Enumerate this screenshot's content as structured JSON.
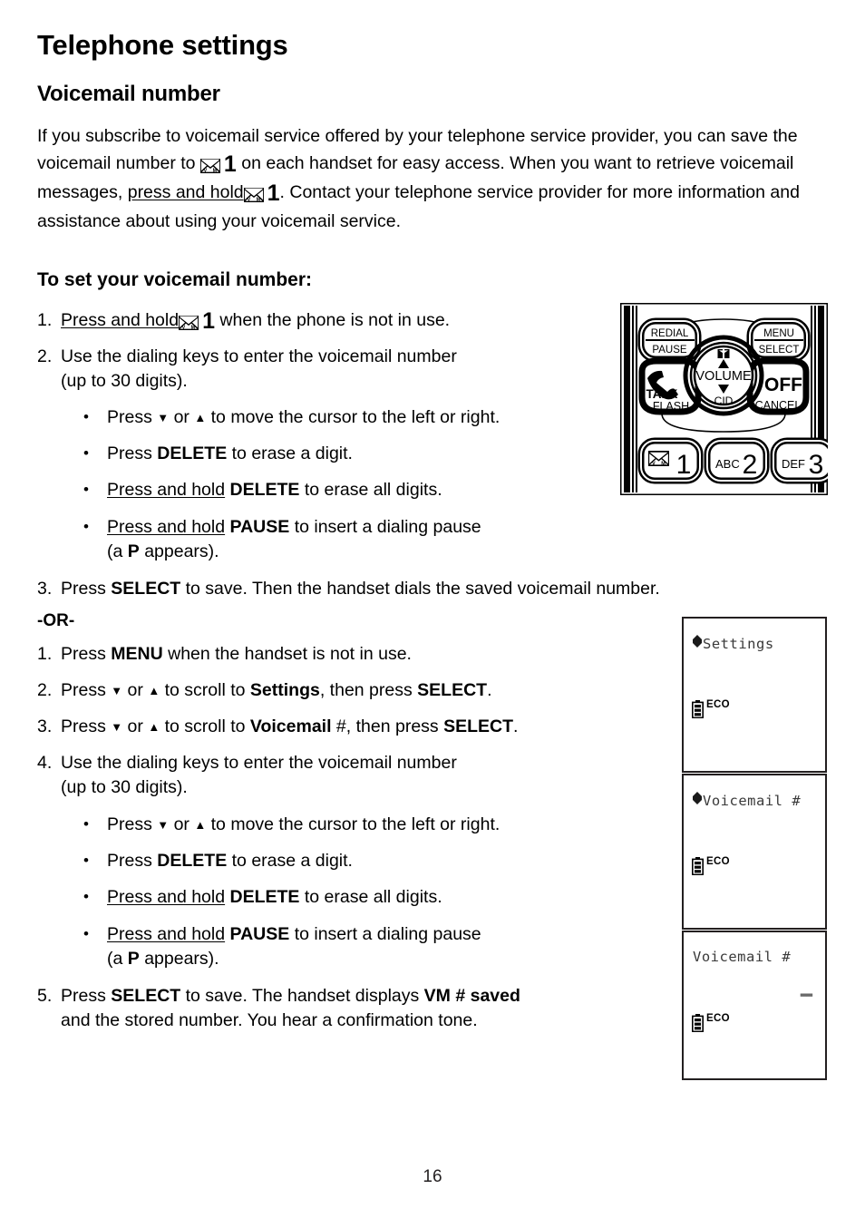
{
  "document": {
    "title": "Telephone settings",
    "section_title": "Voicemail number",
    "page_number": "16"
  },
  "intro": {
    "part1": "If you subscribe to voicemail service offered by your telephone service provider, you can save the voicemail number to ",
    "part2": " on each handset for easy access. When you want to retrieve voicemail messages, ",
    "press_and_hold": "press and hold",
    "part3": ". Contact your telephone service provider for more information and assistance about using your voicemail service.",
    "vm_key_label": "1",
    "vm_icon": "envelope-voicemail-icon"
  },
  "procedure_1": {
    "heading": "To set your voicemail number:",
    "steps": [
      {
        "num": "1.",
        "press_and_hold": "Press and hold",
        "vm_key_label": "1",
        "after": "when the phone is not in use."
      },
      {
        "num": "2.",
        "line1": "Use the dialing keys to enter the voicemail number",
        "line2": "(up to 30 digits)."
      }
    ],
    "bullets": [
      {
        "lead": "Press",
        "down_arrow": "▼",
        "or": "or",
        "up_arrow": "▲",
        "tail": "to move the cursor to the left or right."
      },
      {
        "lead": "Press",
        "key": "DELETE",
        "tail": "to erase a digit."
      },
      {
        "underlined": "Press and hold",
        "key": "DELETE",
        "tail": "to erase all digits."
      },
      {
        "underlined": "Press and hold",
        "key": "PAUSE",
        "tail": "to insert a dialing pause",
        "line2_pre": "(a ",
        "line2_key": "P",
        "line2_post": " appears)."
      }
    ],
    "final_step": {
      "num": "3.",
      "pre": "Press ",
      "key": "SELECT",
      "post": " to save. Then the handset dials the saved voicemail number."
    }
  },
  "or_label": "-OR-",
  "procedure_2": {
    "steps": [
      {
        "num": "1.",
        "pre": "Press ",
        "key": "MENU",
        "post": " when the handset is not in use."
      },
      {
        "num": "2.",
        "pre": "Press ",
        "down_arrow": "▼",
        "or": " or ",
        "up_arrow": "▲",
        "mid": " to scroll to ",
        "key1": "Settings",
        "mid2": ", then press ",
        "key2": "SELECT",
        "post": "."
      },
      {
        "num": "3.",
        "pre": "Press ",
        "down_arrow": "▼",
        "or": " or ",
        "up_arrow": "▲",
        "mid": " to scroll to ",
        "key1": "Voicemail",
        "key1_suffix": " #",
        "mid2": ", then press ",
        "key2": "SELECT",
        "post": "."
      },
      {
        "num": "4.",
        "line1": "Use the dialing keys to enter the voicemail number",
        "line2": "(up to 30 digits)."
      }
    ],
    "bullets": [
      {
        "lead": "Press",
        "down_arrow": "▼",
        "or": "or",
        "up_arrow": "▲",
        "tail": "to move the cursor to the left or right."
      },
      {
        "lead": "Press",
        "key": "DELETE",
        "tail": "to erase a digit."
      },
      {
        "underlined": "Press and hold",
        "key": "DELETE",
        "tail": "to erase all digits."
      },
      {
        "underlined": "Press and hold",
        "key": "PAUSE",
        "tail": "to insert a dialing pause",
        "line2_pre": "(a ",
        "line2_key": "P",
        "line2_post": " appears)."
      }
    ],
    "final_step": {
      "num": "5.",
      "pre": "Press ",
      "key": "SELECT",
      "post": " to save. The handset displays ",
      "display": "VM # saved",
      "line2": "and the stored number. You hear a confirmation tone."
    }
  },
  "phone_diagram": {
    "name": "handset-keypad-diagram",
    "buttons": {
      "redial": "REDIAL",
      "pause": "PAUSE",
      "menu": "MENU",
      "select": "SELECT",
      "talk": "TALK",
      "flash": "FLASH",
      "off": "OFF",
      "cancel": "CANCEL",
      "volume": "VOLUME",
      "cid": "CID",
      "up_arrow": "▲",
      "down_arrow": "▼",
      "key1_digit": "1",
      "key1_letters": "VM",
      "key2_digit": "2",
      "key2_letters": "ABC",
      "key3_digit": "3",
      "key3_letters": "DEF"
    }
  },
  "lcd_screens": [
    {
      "name": "lcd-settings",
      "indicator": "⬥",
      "title": "Settings",
      "battery": "ECO",
      "cursor": ""
    },
    {
      "name": "lcd-voicemail-menu",
      "indicator": "⬥",
      "title": "Voicemail #",
      "battery": "ECO",
      "cursor": ""
    },
    {
      "name": "lcd-voicemail-entry",
      "indicator": "",
      "title": "Voicemail #",
      "battery": "ECO",
      "cursor": "▂▂"
    }
  ],
  "colors": {
    "ink": "#231f20",
    "lcd_text": "#3a3a3a"
  }
}
